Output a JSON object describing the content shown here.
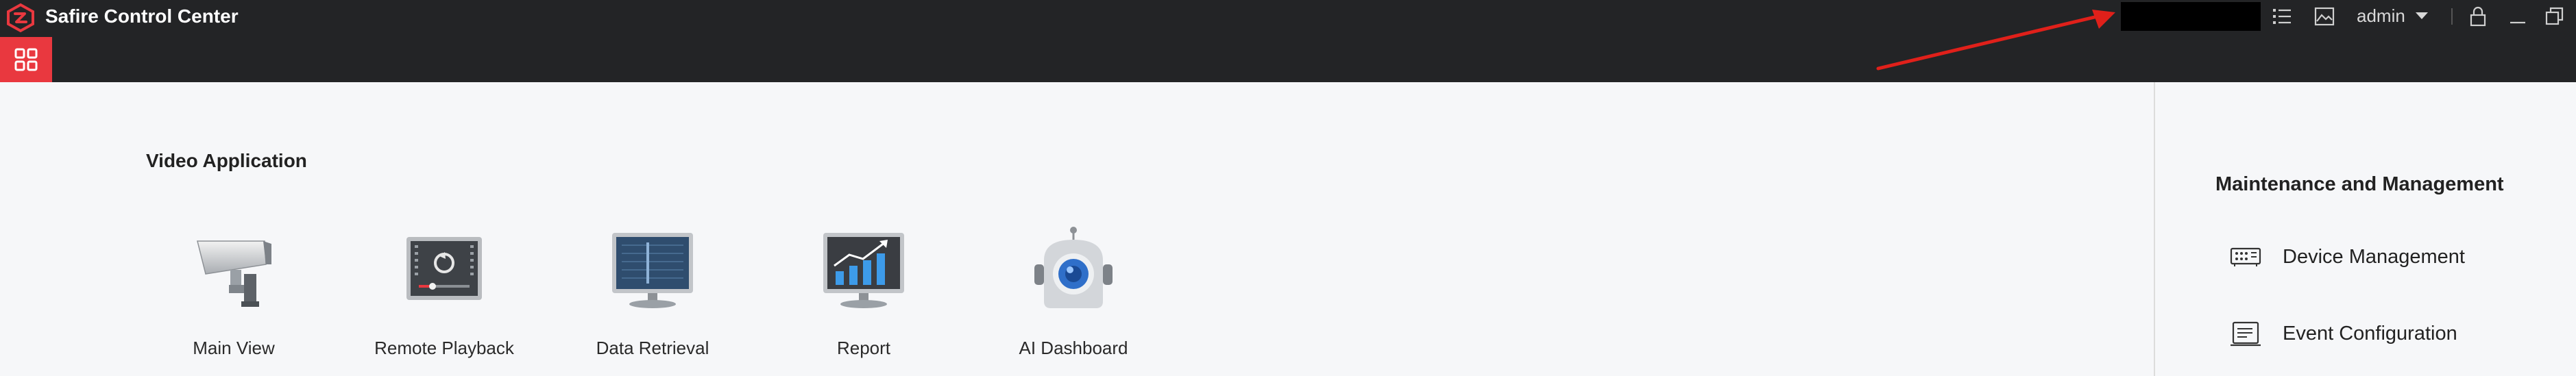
{
  "app": {
    "title": "Safire Control Center"
  },
  "titlebar": {
    "user": "admin",
    "icons": [
      "task-list-icon",
      "image-icon",
      "lock-icon",
      "minimize-icon",
      "restore-icon"
    ]
  },
  "colors": {
    "accent": "#e9383f",
    "titlebar": "#232426",
    "background": "#f6f7f9",
    "annotation": "#e0201a"
  },
  "video_application": {
    "title": "Video Application",
    "apps": [
      {
        "label": "Main View",
        "icon": "camera-icon"
      },
      {
        "label": "Remote Playback",
        "icon": "playback-icon"
      },
      {
        "label": "Data Retrieval",
        "icon": "monitor-search-icon"
      },
      {
        "label": "Report",
        "icon": "report-chart-icon"
      },
      {
        "label": "AI Dashboard",
        "icon": "robot-icon"
      }
    ]
  },
  "maintenance": {
    "title": "Maintenance and Management",
    "items": [
      {
        "label": "Device Management",
        "icon": "device-icon"
      },
      {
        "label": "Event Configuration",
        "icon": "event-icon"
      }
    ]
  }
}
